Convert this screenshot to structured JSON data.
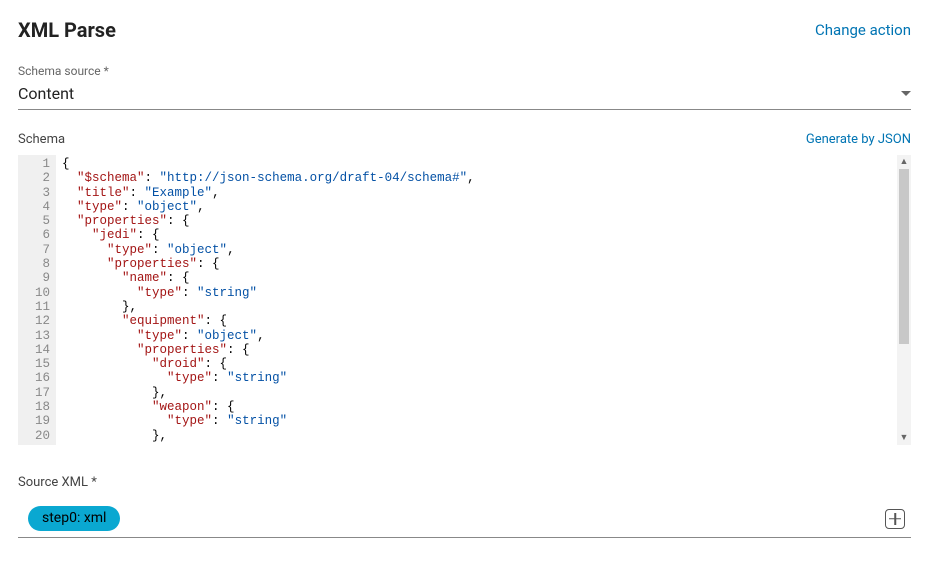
{
  "header": {
    "title": "XML Parse",
    "change_action": "Change action"
  },
  "schema_source": {
    "label": "Schema source *",
    "value": "Content"
  },
  "schema": {
    "label": "Schema",
    "generate_link": "Generate by JSON",
    "content_json": {
      "$schema": "http://json-schema.org/draft-04/schema#",
      "title": "Example",
      "type": "object",
      "properties": {
        "jedi": {
          "type": "object",
          "properties": {
            "name": {
              "type": "string"
            },
            "equipment": {
              "type": "object",
              "properties": {
                "droid": {
                  "type": "string"
                },
                "weapon": {
                  "type": "string"
                }
              }
            }
          }
        }
      }
    },
    "visible_line_count": 20,
    "code_tokens": [
      [
        [
          "p",
          "{"
        ]
      ],
      [
        [
          "p",
          "  "
        ],
        [
          "k",
          "\"$schema\""
        ],
        [
          "p",
          ": "
        ],
        [
          "s",
          "\"http://json-schema.org/draft-04/schema#\""
        ],
        [
          "p",
          ","
        ]
      ],
      [
        [
          "p",
          "  "
        ],
        [
          "k",
          "\"title\""
        ],
        [
          "p",
          ": "
        ],
        [
          "s",
          "\"Example\""
        ],
        [
          "p",
          ","
        ]
      ],
      [
        [
          "p",
          "  "
        ],
        [
          "k",
          "\"type\""
        ],
        [
          "p",
          ": "
        ],
        [
          "s",
          "\"object\""
        ],
        [
          "p",
          ","
        ]
      ],
      [
        [
          "p",
          "  "
        ],
        [
          "k",
          "\"properties\""
        ],
        [
          "p",
          ": {"
        ]
      ],
      [
        [
          "p",
          "    "
        ],
        [
          "k",
          "\"jedi\""
        ],
        [
          "p",
          ": {"
        ]
      ],
      [
        [
          "p",
          "      "
        ],
        [
          "k",
          "\"type\""
        ],
        [
          "p",
          ": "
        ],
        [
          "s",
          "\"object\""
        ],
        [
          "p",
          ","
        ]
      ],
      [
        [
          "p",
          "      "
        ],
        [
          "k",
          "\"properties\""
        ],
        [
          "p",
          ": {"
        ]
      ],
      [
        [
          "p",
          "        "
        ],
        [
          "k",
          "\"name\""
        ],
        [
          "p",
          ": {"
        ]
      ],
      [
        [
          "p",
          "          "
        ],
        [
          "k",
          "\"type\""
        ],
        [
          "p",
          ": "
        ],
        [
          "s",
          "\"string\""
        ]
      ],
      [
        [
          "p",
          "        },"
        ]
      ],
      [
        [
          "p",
          "        "
        ],
        [
          "k",
          "\"equipment\""
        ],
        [
          "p",
          ": {"
        ]
      ],
      [
        [
          "p",
          "          "
        ],
        [
          "k",
          "\"type\""
        ],
        [
          "p",
          ": "
        ],
        [
          "s",
          "\"object\""
        ],
        [
          "p",
          ","
        ]
      ],
      [
        [
          "p",
          "          "
        ],
        [
          "k",
          "\"properties\""
        ],
        [
          "p",
          ": {"
        ]
      ],
      [
        [
          "p",
          "            "
        ],
        [
          "k",
          "\"droid\""
        ],
        [
          "p",
          ": {"
        ]
      ],
      [
        [
          "p",
          "              "
        ],
        [
          "k",
          "\"type\""
        ],
        [
          "p",
          ": "
        ],
        [
          "s",
          "\"string\""
        ]
      ],
      [
        [
          "p",
          "            },"
        ]
      ],
      [
        [
          "p",
          "            "
        ],
        [
          "k",
          "\"weapon\""
        ],
        [
          "p",
          ": {"
        ]
      ],
      [
        [
          "p",
          "              "
        ],
        [
          "k",
          "\"type\""
        ],
        [
          "p",
          ": "
        ],
        [
          "s",
          "\"string\""
        ]
      ],
      [
        [
          "p",
          "            },"
        ]
      ]
    ]
  },
  "source_xml": {
    "label": "Source XML *",
    "chip": "step0: xml"
  }
}
